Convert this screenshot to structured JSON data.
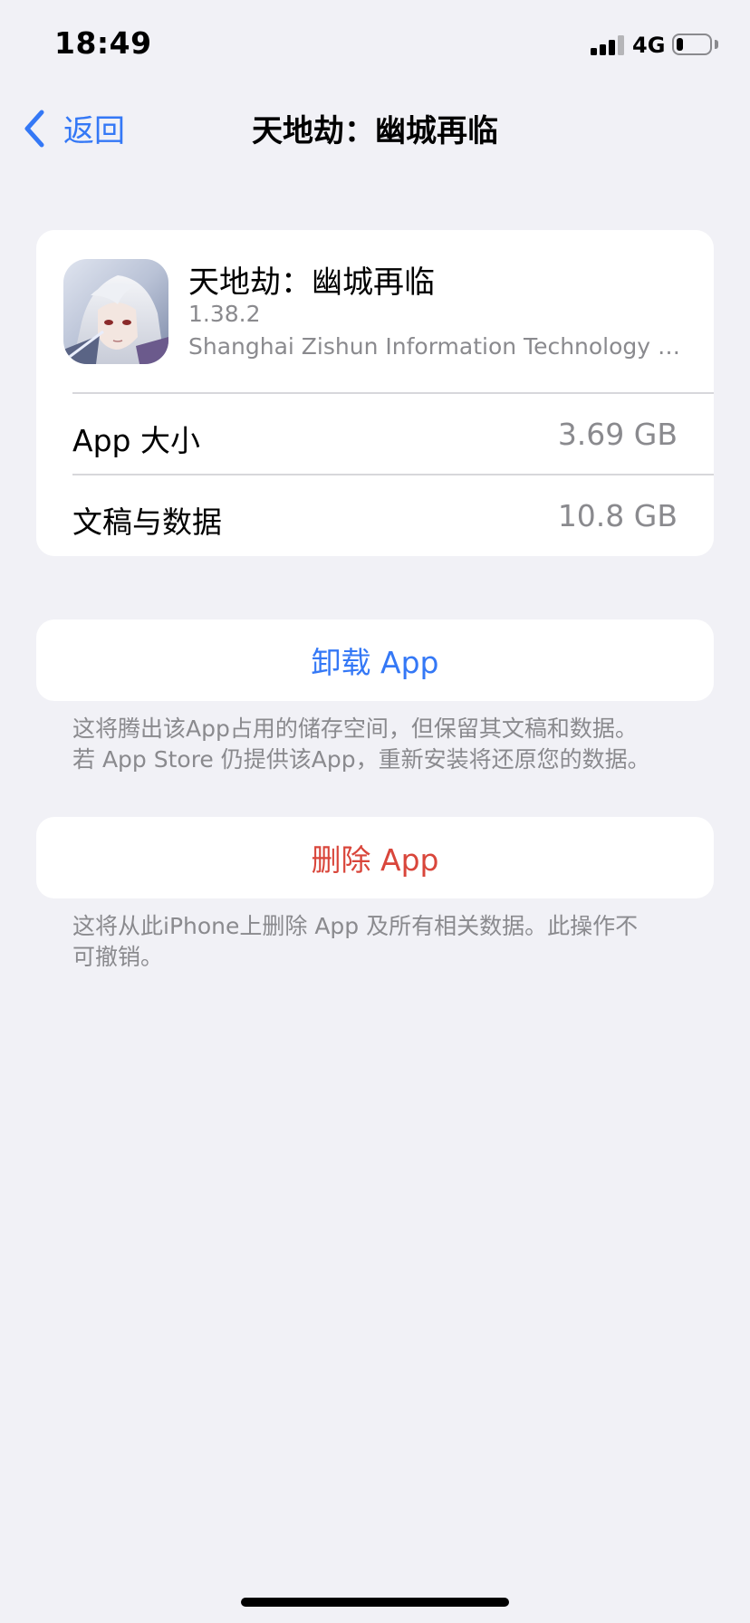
{
  "status_bar": {
    "time": "18:49",
    "network": "4G",
    "signal_bars_filled": 3,
    "signal_bars_total": 4,
    "battery_level": 0.2
  },
  "nav": {
    "back_label": "返回",
    "title": "天地劫：幽城再临"
  },
  "app": {
    "name": "天地劫：幽城再临",
    "version": "1.38.2",
    "developer": "Shanghai Zishun Information Technology Co...."
  },
  "rows": [
    {
      "label": "App 大小",
      "value": "3.69 GB"
    },
    {
      "label": "文稿与数据",
      "value": "10.8 GB"
    }
  ],
  "offload": {
    "label": "卸载 App",
    "description_line1": "这将腾出该App占用的储存空间，但保留其文稿和数据。",
    "description_line2": "若 App Store 仍提供该App，重新安装将还原您的数据。"
  },
  "delete": {
    "label": "删除 App",
    "description_line1": "这将从此iPhone上删除 App 及所有相关数据。此操作不",
    "description_line2": "可撤销。"
  },
  "colors": {
    "background": "#f1f1f6",
    "accent_blue": "#3478f6",
    "destructive_red": "#d9463b",
    "secondary_text": "#8a8a8e"
  },
  "icons": {
    "back": "chevron-left-icon",
    "signal": "cellular-signal-icon",
    "battery": "battery-icon"
  }
}
